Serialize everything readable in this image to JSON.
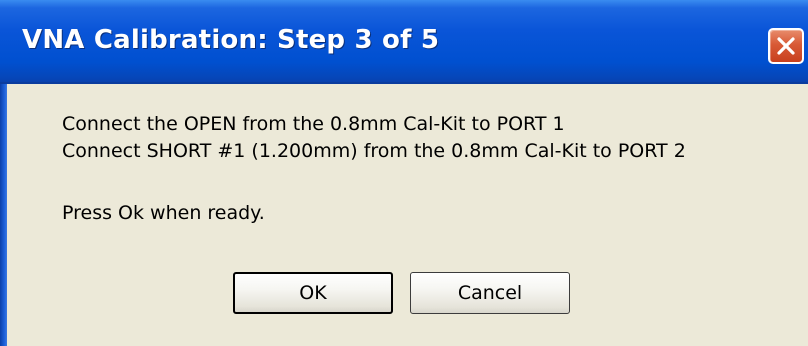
{
  "dialog": {
    "title": "VNA Calibration:  Step 3 of 5",
    "close_icon": "close-icon",
    "messages": [
      "Connect the OPEN  from the 0.8mm Cal-Kit to PORT 1",
      "Connect SHORT #1 (1.200mm) from the 0.8mm Cal-Kit to PORT 2",
      "Press Ok when ready."
    ],
    "buttons": {
      "ok_label": "OK",
      "cancel_label": "Cancel"
    }
  },
  "colors": {
    "titlebar": "#0050d0",
    "close_button": "#d85a36",
    "window_body": "#ece9d8"
  }
}
